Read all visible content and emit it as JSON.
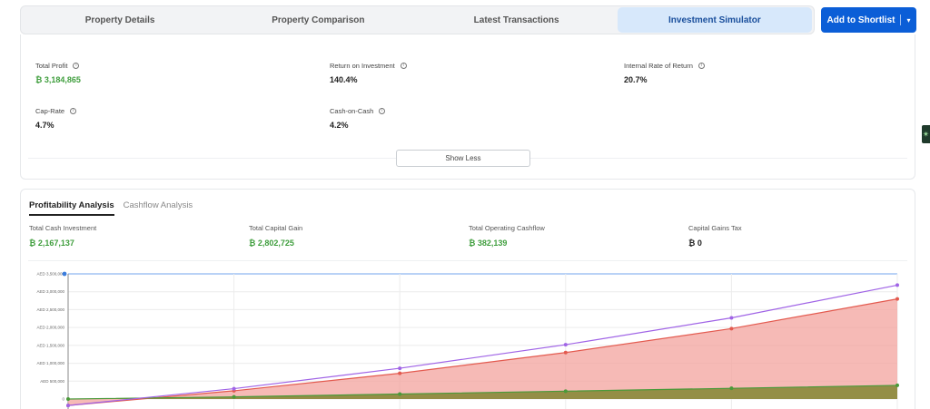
{
  "tabs": [
    {
      "label": "Property Details",
      "active": false
    },
    {
      "label": "Property Comparison",
      "active": false
    },
    {
      "label": "Latest Transactions",
      "active": false
    },
    {
      "label": "Investment Simulator",
      "active": true
    }
  ],
  "shortlist_button": {
    "label": "Add to Shortlist",
    "icon": "chevron-down-icon"
  },
  "kpis": {
    "total_profit": {
      "label": "Total Profit",
      "value": "₿ 3,184,865"
    },
    "roi": {
      "label": "Return on Investment",
      "value": "140.4%"
    },
    "irr": {
      "label": "Internal Rate of Return",
      "value": "20.7%"
    },
    "cap_rate": {
      "label": "Cap-Rate",
      "value": "4.7%"
    },
    "cash_on_cash": {
      "label": "Cash-on-Cash",
      "value": "4.2%"
    }
  },
  "show_less_label": "Show Less",
  "analysis": {
    "tabs": [
      {
        "label": "Profitability Analysis",
        "active": true
      },
      {
        "label": "Cashflow Analysis",
        "active": false
      }
    ],
    "stats": {
      "cash_investment": {
        "label": "Total Cash Investment",
        "value": "₿ 2,167,137"
      },
      "capital_gain": {
        "label": "Total Capital Gain",
        "value": "₿ 2,802,725"
      },
      "operating_cashflow": {
        "label": "Total Operating Cashflow",
        "value": "₿ 382,139"
      },
      "capital_gains_tax": {
        "label": "Capital Gains Tax",
        "value": "₿ 0"
      }
    }
  },
  "colors": {
    "accent": "#0b5ed7",
    "positive": "#3f9e3d",
    "gain_fill": "#f3a39d",
    "cashflow_fill": "#8a8a3a",
    "total_line": "#a064e6"
  },
  "chart_data": {
    "type": "area",
    "x": [
      0,
      1,
      2,
      3,
      4,
      5
    ],
    "y_tick_labels": [
      "0",
      "AED 500,000",
      "AED 1,000,000",
      "AED 1,500,000",
      "AED 2,000,000",
      "AED 2,500,000",
      "AED 3,000,000",
      "AED 3,500,000"
    ],
    "ylim": [
      -200000,
      3500000
    ],
    "grid": true,
    "series": [
      {
        "values": [
          -180000,
          230000,
          720000,
          1300000,
          1970000,
          2800000
        ],
        "color": "#e35a4f"
      },
      {
        "values": [
          0,
          60000,
          140000,
          220000,
          300000,
          382139
        ],
        "color": "#4a9a3a"
      },
      {
        "values": [
          -180000,
          290000,
          860000,
          1520000,
          2270000,
          3184865
        ],
        "color": "#a064e6"
      }
    ]
  }
}
